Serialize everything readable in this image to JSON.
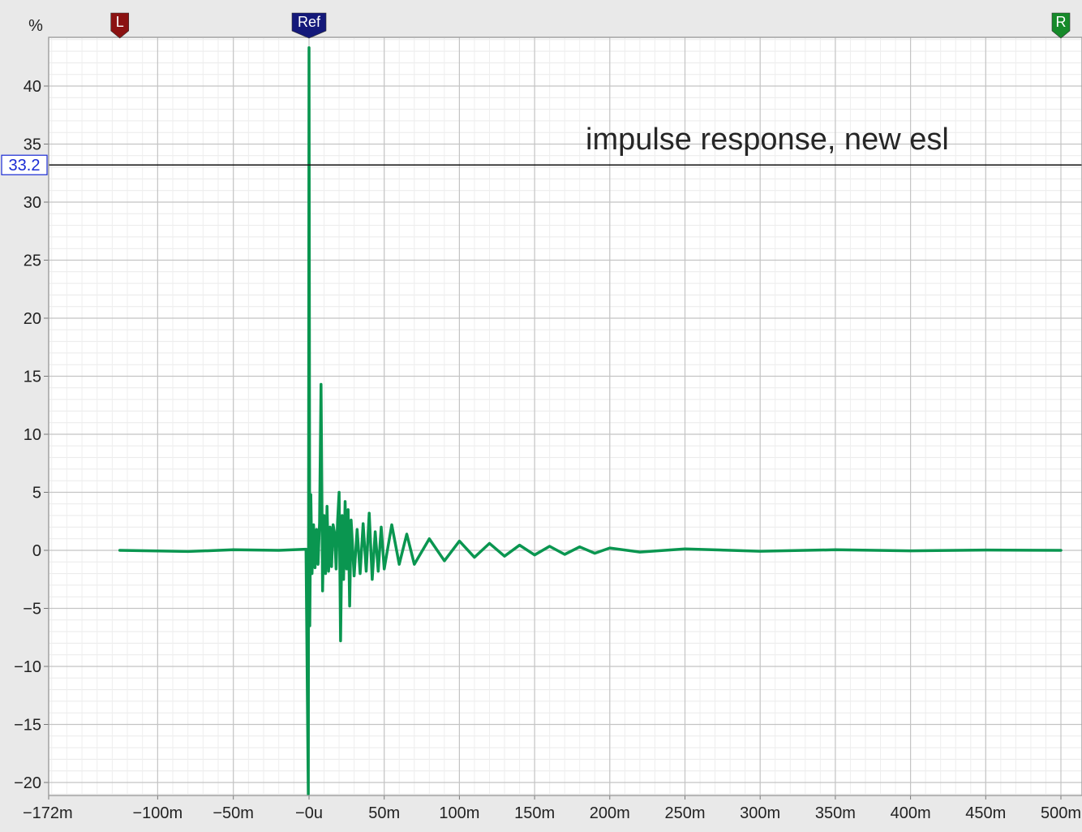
{
  "chart_data": {
    "type": "line",
    "title": "impulse response, new esl",
    "ylabel": "%",
    "xlabel": "",
    "xlim": [
      -0.172,
      0.5
    ],
    "ylim": [
      -21,
      44
    ],
    "y_ticks": [
      {
        "value": 40,
        "label": "40"
      },
      {
        "value": 35,
        "label": "35"
      },
      {
        "value": 30,
        "label": "30"
      },
      {
        "value": 25,
        "label": "25"
      },
      {
        "value": 20,
        "label": "20"
      },
      {
        "value": 15,
        "label": "15"
      },
      {
        "value": 10,
        "label": "10"
      },
      {
        "value": 5,
        "label": "5"
      },
      {
        "value": 0,
        "label": "0"
      },
      {
        "value": -5,
        "label": "−5"
      },
      {
        "value": -10,
        "label": "−10"
      },
      {
        "value": -15,
        "label": "−15"
      },
      {
        "value": -20,
        "label": "−20"
      }
    ],
    "x_ticks": [
      {
        "value": -0.172,
        "label": "−172m"
      },
      {
        "value": -0.1,
        "label": "−100m"
      },
      {
        "value": -0.05,
        "label": "−50m"
      },
      {
        "value": 0,
        "label": "−0u"
      },
      {
        "value": 0.05,
        "label": "50m"
      },
      {
        "value": 0.1,
        "label": "100m"
      },
      {
        "value": 0.15,
        "label": "150m"
      },
      {
        "value": 0.2,
        "label": "200m"
      },
      {
        "value": 0.25,
        "label": "250m"
      },
      {
        "value": 0.3,
        "label": "300m"
      },
      {
        "value": 0.35,
        "label": "350m"
      },
      {
        "value": 0.4,
        "label": "400m"
      },
      {
        "value": 0.45,
        "label": "450m"
      },
      {
        "value": 0.5,
        "label": "500m"
      }
    ],
    "cursor": {
      "value": 33.2,
      "label": "33.2"
    },
    "markers": [
      {
        "id": "left",
        "label": "L",
        "x": -0.125,
        "color": "#8b1212"
      },
      {
        "id": "ref",
        "label": "Ref",
        "x": 0,
        "color": "#14197a"
      },
      {
        "id": "right",
        "label": "R",
        "x": 0.5,
        "color": "#168a2a"
      }
    ],
    "series": [
      {
        "color": "#0a9650",
        "x": [
          -0.125,
          -0.1,
          -0.08,
          -0.05,
          -0.02,
          -0.002,
          -0.0005,
          0,
          0.0005,
          0.0012,
          0.002,
          0.003,
          0.004,
          0.005,
          0.006,
          0.007,
          0.008,
          0.009,
          0.01,
          0.011,
          0.012,
          0.013,
          0.014,
          0.015,
          0.016,
          0.017,
          0.018,
          0.019,
          0.02,
          0.021,
          0.022,
          0.023,
          0.024,
          0.025,
          0.026,
          0.027,
          0.028,
          0.03,
          0.032,
          0.034,
          0.036,
          0.038,
          0.04,
          0.042,
          0.044,
          0.046,
          0.048,
          0.05,
          0.055,
          0.06,
          0.065,
          0.07,
          0.08,
          0.09,
          0.1,
          0.11,
          0.12,
          0.13,
          0.14,
          0.15,
          0.16,
          0.17,
          0.18,
          0.19,
          0.2,
          0.22,
          0.25,
          0.3,
          0.35,
          0.4,
          0.45,
          0.5
        ],
        "y": [
          0,
          -0.05,
          -0.1,
          0.05,
          0,
          0.1,
          -21,
          43.3,
          -6.5,
          4.8,
          -2.0,
          2.2,
          -1.5,
          1.8,
          -1.2,
          2.4,
          14.3,
          -3.5,
          3.0,
          -2.0,
          3.8,
          -1.8,
          2.0,
          -1.4,
          2.2,
          1.5,
          -1.6,
          2.5,
          5.0,
          -7.8,
          3.0,
          -2.5,
          4.2,
          -1.6,
          3.5,
          -4.8,
          2.6,
          -2.2,
          1.8,
          -2.0,
          2.3,
          -1.8,
          3.2,
          -2.5,
          1.6,
          -1.8,
          2.0,
          -1.6,
          2.2,
          -1.2,
          1.4,
          -1.2,
          1.0,
          -0.9,
          0.8,
          -0.6,
          0.6,
          -0.5,
          0.45,
          -0.4,
          0.35,
          -0.35,
          0.3,
          -0.25,
          0.2,
          -0.15,
          0.12,
          -0.08,
          0.05,
          -0.04,
          0.03,
          0
        ]
      }
    ]
  }
}
